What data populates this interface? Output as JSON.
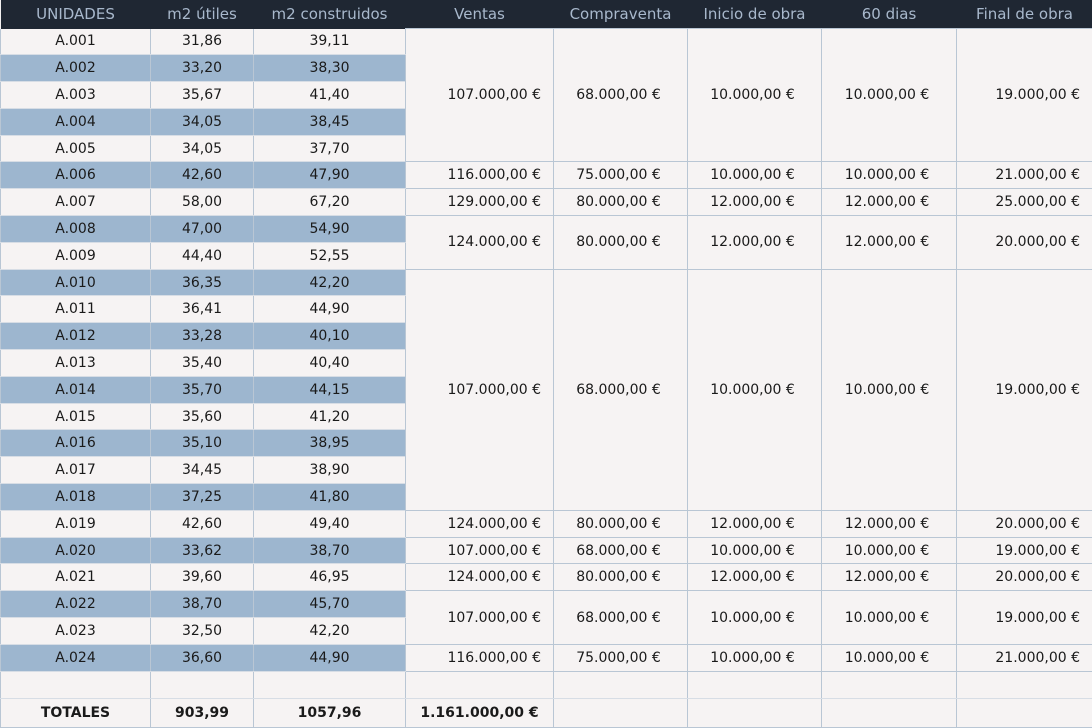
{
  "headers": [
    "UNIDADES",
    "m2 útiles",
    "m2 construidos",
    "Ventas",
    "Compraventa",
    "Inicio de obra",
    "60 dias",
    "Final de obra"
  ],
  "units": [
    {
      "unidad": "A.001",
      "utiles": "31,86",
      "construidos": "39,11"
    },
    {
      "unidad": "A.002",
      "utiles": "33,20",
      "construidos": "38,30"
    },
    {
      "unidad": "A.003",
      "utiles": "35,67",
      "construidos": "41,40"
    },
    {
      "unidad": "A.004",
      "utiles": "34,05",
      "construidos": "38,45"
    },
    {
      "unidad": "A.005",
      "utiles": "34,05",
      "construidos": "37,70"
    },
    {
      "unidad": "A.006",
      "utiles": "42,60",
      "construidos": "47,90"
    },
    {
      "unidad": "A.007",
      "utiles": "58,00",
      "construidos": "67,20"
    },
    {
      "unidad": "A.008",
      "utiles": "47,00",
      "construidos": "54,90"
    },
    {
      "unidad": "A.009",
      "utiles": "44,40",
      "construidos": "52,55"
    },
    {
      "unidad": "A.010",
      "utiles": "36,35",
      "construidos": "42,20"
    },
    {
      "unidad": "A.011",
      "utiles": "36,41",
      "construidos": "44,90"
    },
    {
      "unidad": "A.012",
      "utiles": "33,28",
      "construidos": "40,10"
    },
    {
      "unidad": "A.013",
      "utiles": "35,40",
      "construidos": "40,40"
    },
    {
      "unidad": "A.014",
      "utiles": "35,70",
      "construidos": "44,15"
    },
    {
      "unidad": "A.015",
      "utiles": "35,60",
      "construidos": "41,20"
    },
    {
      "unidad": "A.016",
      "utiles": "35,10",
      "construidos": "38,95"
    },
    {
      "unidad": "A.017",
      "utiles": "34,45",
      "construidos": "38,90"
    },
    {
      "unidad": "A.018",
      "utiles": "37,25",
      "construidos": "41,80"
    },
    {
      "unidad": "A.019",
      "utiles": "42,60",
      "construidos": "49,40"
    },
    {
      "unidad": "A.020",
      "utiles": "33,62",
      "construidos": "38,70"
    },
    {
      "unidad": "A.021",
      "utiles": "39,60",
      "construidos": "46,95"
    },
    {
      "unidad": "A.022",
      "utiles": "38,70",
      "construidos": "45,70"
    },
    {
      "unidad": "A.023",
      "utiles": "32,50",
      "construidos": "42,20"
    },
    {
      "unidad": "A.024",
      "utiles": "36,60",
      "construidos": "44,90"
    }
  ],
  "groups": [
    {
      "rows": 5,
      "ventas": "107.000,00 €",
      "compraventa": "68.000,00 €",
      "inicio": "10.000,00 €",
      "dias60": "10.000,00 €",
      "final": "19.000,00 €"
    },
    {
      "rows": 1,
      "ventas": "116.000,00 €",
      "compraventa": "75.000,00 €",
      "inicio": "10.000,00 €",
      "dias60": "10.000,00 €",
      "final": "21.000,00 €"
    },
    {
      "rows": 1,
      "ventas": "129.000,00 €",
      "compraventa": "80.000,00 €",
      "inicio": "12.000,00 €",
      "dias60": "12.000,00 €",
      "final": "25.000,00 €"
    },
    {
      "rows": 2,
      "ventas": "124.000,00 €",
      "compraventa": "80.000,00 €",
      "inicio": "12.000,00 €",
      "dias60": "12.000,00 €",
      "final": "20.000,00 €"
    },
    {
      "rows": 9,
      "ventas": "107.000,00 €",
      "compraventa": "68.000,00 €",
      "inicio": "10.000,00 €",
      "dias60": "10.000,00 €",
      "final": "19.000,00 €"
    },
    {
      "rows": 1,
      "ventas": "124.000,00 €",
      "compraventa": "80.000,00 €",
      "inicio": "12.000,00 €",
      "dias60": "12.000,00 €",
      "final": "20.000,00 €"
    },
    {
      "rows": 1,
      "ventas": "107.000,00 €",
      "compraventa": "68.000,00 €",
      "inicio": "10.000,00 €",
      "dias60": "10.000,00 €",
      "final": "19.000,00 €"
    },
    {
      "rows": 1,
      "ventas": "124.000,00 €",
      "compraventa": "80.000,00 €",
      "inicio": "12.000,00 €",
      "dias60": "12.000,00 €",
      "final": "20.000,00 €"
    },
    {
      "rows": 2,
      "ventas": "107.000,00 €",
      "compraventa": "68.000,00 €",
      "inicio": "10.000,00 €",
      "dias60": "10.000,00 €",
      "final": "19.000,00 €"
    },
    {
      "rows": 1,
      "ventas": "116.000,00 €",
      "compraventa": "75.000,00 €",
      "inicio": "10.000,00 €",
      "dias60": "10.000,00 €",
      "final": "21.000,00 €"
    }
  ],
  "totals": {
    "label": "TOTALES",
    "utiles": "903,99",
    "construidos": "1057,96",
    "ventas": "1.161.000,00 €"
  },
  "colors": {
    "header_bg": "#1f2733",
    "header_text": "#a8b8cc",
    "row_blue": "#9db6cf",
    "row_white": "#f6f3f3",
    "grid": "#b9c6d4"
  }
}
